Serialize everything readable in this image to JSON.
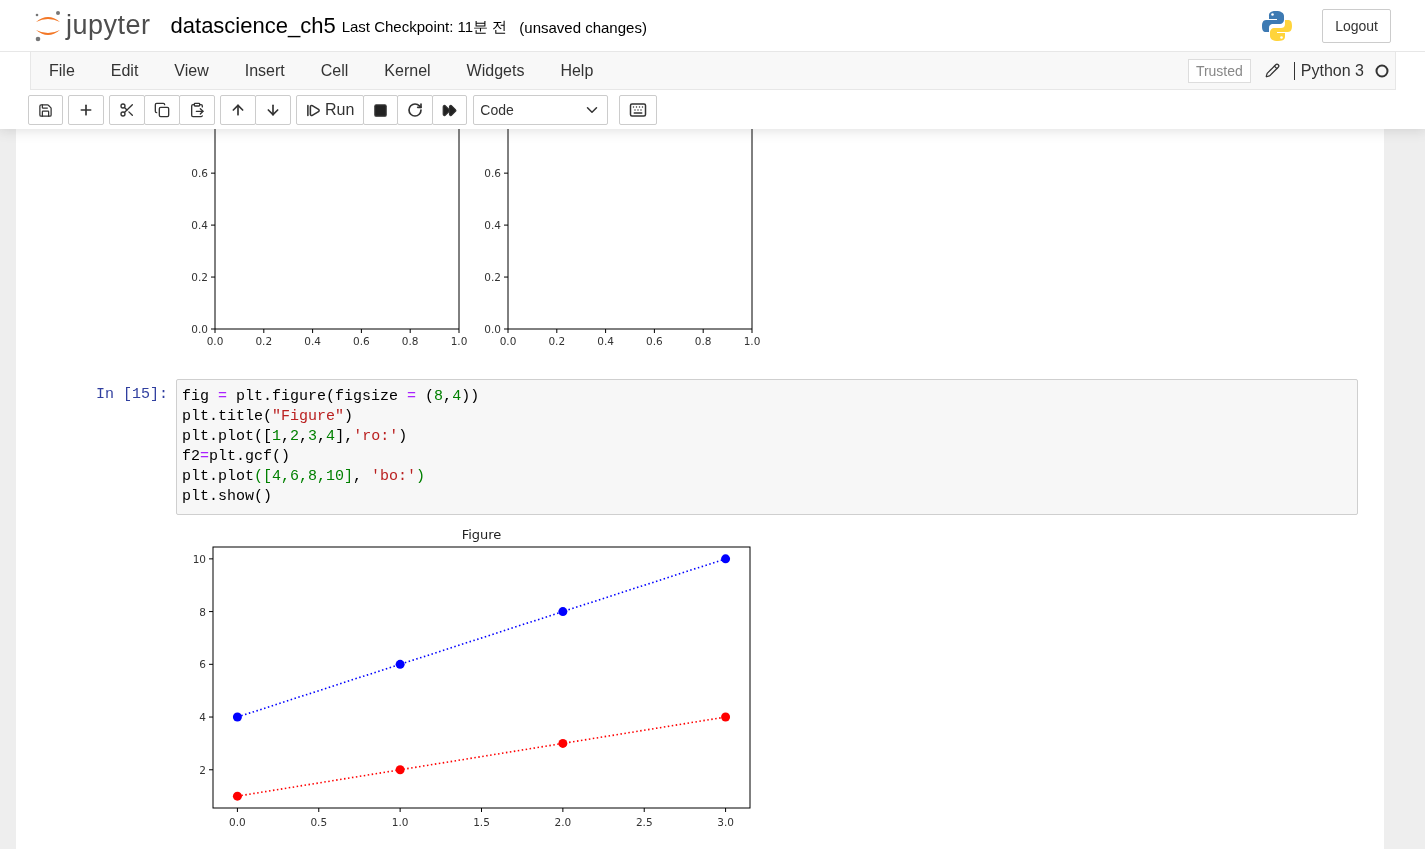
{
  "header": {
    "logo_text": "jupyter",
    "notebook_name": "datascience_ch5",
    "checkpoint": "Last Checkpoint: 11분 전",
    "autosave_status": "(unsaved changes)",
    "logout": "Logout"
  },
  "menu": [
    "File",
    "Edit",
    "View",
    "Insert",
    "Cell",
    "Kernel",
    "Widgets",
    "Help"
  ],
  "kernel": {
    "trusted": "Trusted",
    "name": "Python 3"
  },
  "toolbar": {
    "run": "Run",
    "cell_type": "Code"
  },
  "outputs_above": [
    {
      "chart_data": {
        "type": "line",
        "xlim": [
          0,
          1
        ],
        "ylim": [
          0,
          0.77
        ],
        "xticks": [
          {
            "value": 0,
            "label": "0.0"
          },
          {
            "value": 0.2,
            "label": "0.2"
          },
          {
            "value": 0.4,
            "label": "0.4"
          },
          {
            "value": 0.6,
            "label": "0.6"
          },
          {
            "value": 0.8,
            "label": "0.8"
          },
          {
            "value": 1,
            "label": "1.0"
          }
        ],
        "yticks": [
          {
            "value": 0,
            "label": "0.0"
          },
          {
            "value": 0.2,
            "label": "0.2"
          },
          {
            "value": 0.4,
            "label": "0.4"
          },
          {
            "value": 0.6,
            "label": "0.6"
          }
        ]
      }
    },
    {
      "chart_data": {
        "type": "line",
        "xlim": [
          0,
          1
        ],
        "ylim": [
          0,
          0.77
        ],
        "xticks": [
          {
            "value": 0,
            "label": "0.0"
          },
          {
            "value": 0.2,
            "label": "0.2"
          },
          {
            "value": 0.4,
            "label": "0.4"
          },
          {
            "value": 0.6,
            "label": "0.6"
          },
          {
            "value": 0.8,
            "label": "0.8"
          },
          {
            "value": 1,
            "label": "1.0"
          }
        ],
        "yticks": [
          {
            "value": 0,
            "label": "0.0"
          },
          {
            "value": 0.2,
            "label": "0.2"
          },
          {
            "value": 0.4,
            "label": "0.4"
          },
          {
            "value": 0.6,
            "label": "0.6"
          }
        ]
      }
    }
  ],
  "cell": {
    "prompt": "In [15]:",
    "code": [
      [
        {
          "kind": "plain",
          "text": "fig "
        },
        {
          "kind": "op",
          "text": "="
        },
        {
          "kind": "plain",
          "text": " plt.figure(figsize "
        },
        {
          "kind": "op",
          "text": "="
        },
        {
          "kind": "plain",
          "text": " ("
        },
        {
          "kind": "num",
          "text": "8"
        },
        {
          "kind": "plain",
          "text": ","
        },
        {
          "kind": "num",
          "text": "4"
        },
        {
          "kind": "plain",
          "text": "))"
        }
      ],
      [
        {
          "kind": "plain",
          "text": "plt.title("
        },
        {
          "kind": "str",
          "text": "\"Figure\""
        },
        {
          "kind": "plain",
          "text": ")"
        }
      ],
      [
        {
          "kind": "plain",
          "text": "plt.plot(["
        },
        {
          "kind": "num",
          "text": "1"
        },
        {
          "kind": "plain",
          "text": ","
        },
        {
          "kind": "num",
          "text": "2"
        },
        {
          "kind": "plain",
          "text": ","
        },
        {
          "kind": "num",
          "text": "3"
        },
        {
          "kind": "plain",
          "text": ","
        },
        {
          "kind": "num",
          "text": "4"
        },
        {
          "kind": "plain",
          "text": "],"
        },
        {
          "kind": "str",
          "text": "'ro:'"
        },
        {
          "kind": "plain",
          "text": ")"
        }
      ],
      [
        {
          "kind": "plain",
          "text": "f2"
        },
        {
          "kind": "op",
          "text": "="
        },
        {
          "kind": "plain",
          "text": "plt.gcf()"
        }
      ],
      [
        {
          "kind": "plain",
          "text": "plt.plot"
        },
        {
          "kind": "num",
          "text": "([4,6,8,10]"
        },
        {
          "kind": "plain",
          "text": ", "
        },
        {
          "kind": "str",
          "text": "'bo:'"
        },
        {
          "kind": "num",
          "text": ")"
        }
      ],
      [
        {
          "kind": "plain",
          "text": "plt.show()"
        }
      ]
    ]
  },
  "output": {
    "chart_data": {
      "type": "line",
      "title": "Figure",
      "x": [
        0,
        1,
        2,
        3
      ],
      "xlim": [
        -0.15,
        3.15
      ],
      "ylim": [
        0.55,
        10.45
      ],
      "series": [
        {
          "color": "#ff0000",
          "line_style": "dotted",
          "marker": "o",
          "values": [
            1,
            2,
            3,
            4
          ]
        },
        {
          "color": "#0000ff",
          "line_style": "dotted",
          "marker": "o",
          "values": [
            4,
            6,
            8,
            10
          ]
        }
      ],
      "xticks": [
        {
          "value": 0,
          "label": "0.0"
        },
        {
          "value": 0.5,
          "label": "0.5"
        },
        {
          "value": 1,
          "label": "1.0"
        },
        {
          "value": 1.5,
          "label": "1.5"
        },
        {
          "value": 2,
          "label": "2.0"
        },
        {
          "value": 2.5,
          "label": "2.5"
        },
        {
          "value": 3,
          "label": "3.0"
        }
      ],
      "yticks": [
        {
          "value": 2,
          "label": "2"
        },
        {
          "value": 4,
          "label": "4"
        },
        {
          "value": 6,
          "label": "6"
        },
        {
          "value": 8,
          "label": "8"
        },
        {
          "value": 10,
          "label": "10"
        }
      ]
    }
  }
}
